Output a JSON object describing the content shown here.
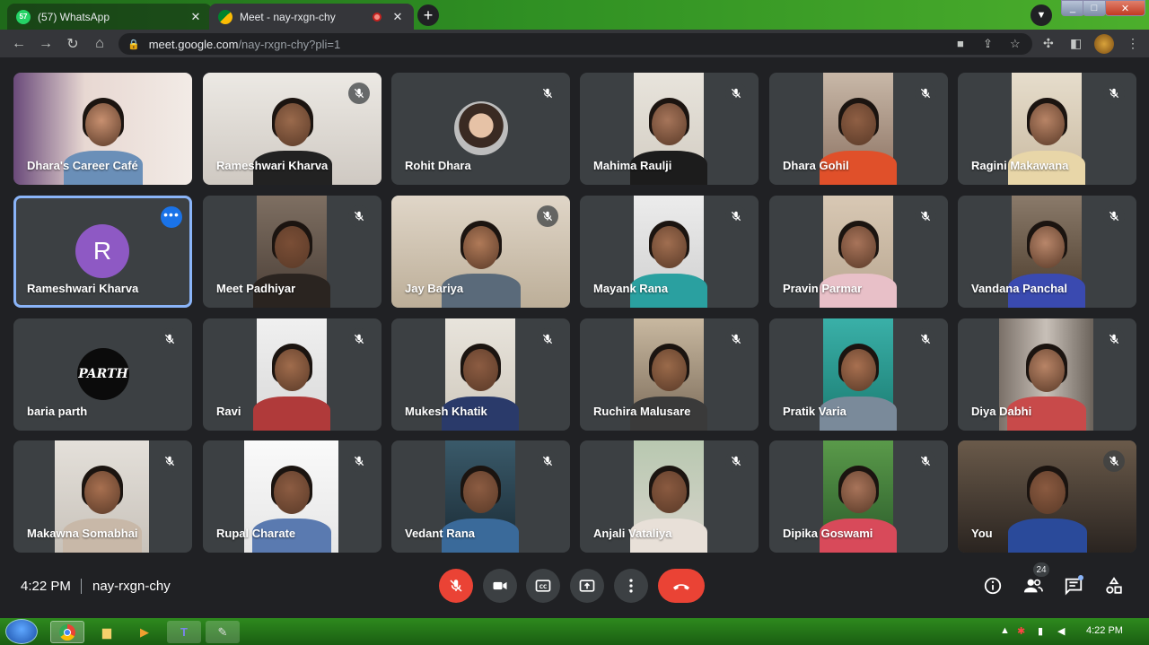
{
  "browser": {
    "tabs": [
      {
        "title": "(57) WhatsApp",
        "badge": "57"
      },
      {
        "title": "Meet - nay-rxgn-chy"
      }
    ],
    "url_host": "meet.google.com",
    "url_path": "/nay-rxgn-chy?pli=1"
  },
  "participants": [
    {
      "name": "Dhara's Career Café",
      "type": "video",
      "muted": false
    },
    {
      "name": "Rameshwari Kharva",
      "type": "video",
      "muted": true
    },
    {
      "name": "Rohit Dhara",
      "type": "photo",
      "muted": true
    },
    {
      "name": "Mahima Raulji",
      "type": "video",
      "muted": true
    },
    {
      "name": "Dhara Gohil",
      "type": "video",
      "muted": true
    },
    {
      "name": "Ragini Makawana",
      "type": "video",
      "muted": true
    },
    {
      "name": "Rameshwari Kharva",
      "type": "letter",
      "letter": "R",
      "muted": false,
      "selected": true
    },
    {
      "name": "Meet Padhiyar",
      "type": "video",
      "muted": true
    },
    {
      "name": "Jay Bariya",
      "type": "video",
      "muted": true
    },
    {
      "name": "Mayank Rana",
      "type": "video",
      "muted": true
    },
    {
      "name": "Pravin Parmar",
      "type": "video",
      "muted": true
    },
    {
      "name": "Vandana Panchal",
      "type": "video",
      "muted": true
    },
    {
      "name": "baria parth",
      "type": "logo",
      "logo_text": "PARTH",
      "muted": true
    },
    {
      "name": "Ravi",
      "type": "video",
      "muted": true
    },
    {
      "name": "Mukesh Khatik",
      "type": "video",
      "muted": true
    },
    {
      "name": "Ruchira Malusare",
      "type": "video",
      "muted": true
    },
    {
      "name": "Pratik Varia",
      "type": "video",
      "muted": true
    },
    {
      "name": "Diya Dabhi",
      "type": "video",
      "muted": true
    },
    {
      "name": "Makawna Somabhai",
      "type": "video",
      "muted": true
    },
    {
      "name": "Rupal Charate",
      "type": "video",
      "muted": true
    },
    {
      "name": "Vedant Rana",
      "type": "video",
      "muted": true
    },
    {
      "name": "Anjali Vataliya",
      "type": "video",
      "muted": true
    },
    {
      "name": "Dipika Goswami",
      "type": "video",
      "muted": true
    },
    {
      "name": "You",
      "type": "video",
      "muted": true
    }
  ],
  "meeting": {
    "time": "4:22 PM",
    "code": "nay-rxgn-chy",
    "participant_count": "24"
  },
  "taskbar": {
    "time": "4:22 PM"
  },
  "colors": {
    "meet_bg": "#202124",
    "tile_bg": "#3c4043",
    "end_call": "#ea4335",
    "selected_outline": "#8ab4f8"
  }
}
